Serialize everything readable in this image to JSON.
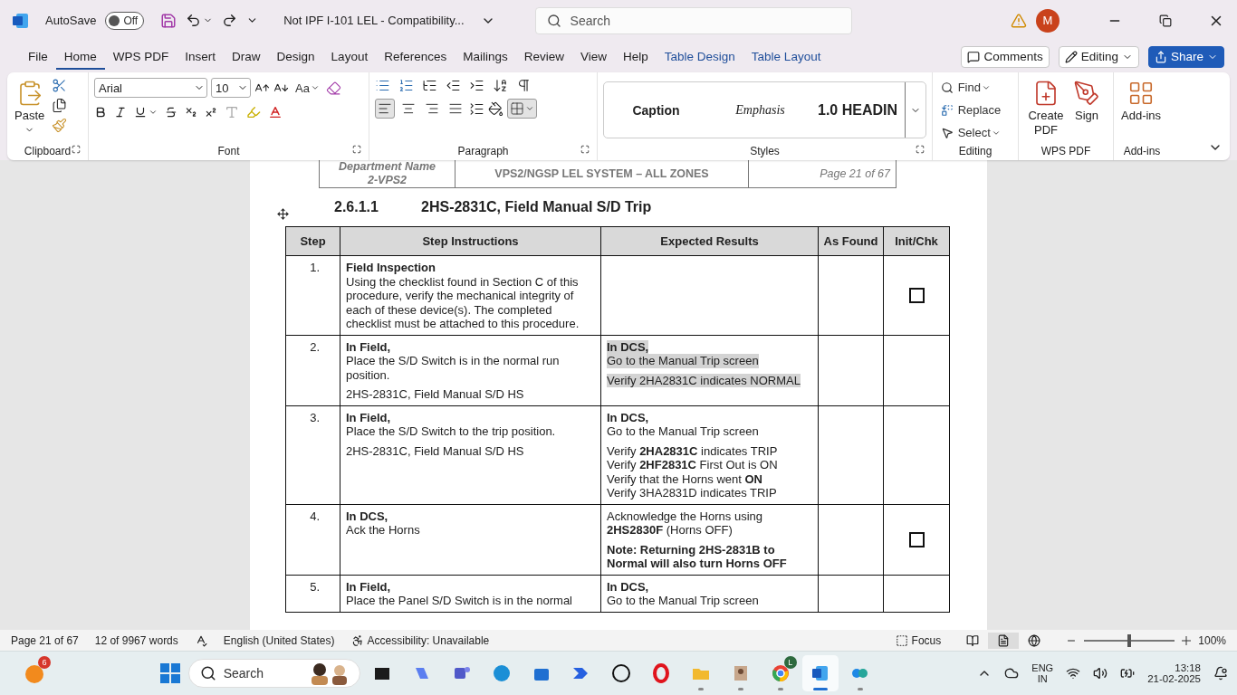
{
  "title_bar": {
    "autosave_label": "AutoSave",
    "autosave": {
      "on": false,
      "label": "Off"
    },
    "document_title": "Not IPF I-101 LEL  -  Compatibility...",
    "search_placeholder": "Search",
    "avatar": "M"
  },
  "menu_tabs": [
    {
      "label": "File",
      "selected": false,
      "kind": "plain"
    },
    {
      "label": "Home",
      "selected": true,
      "kind": "plain"
    },
    {
      "label": "WPS PDF",
      "selected": false,
      "kind": "plain"
    },
    {
      "label": "Insert",
      "selected": false,
      "kind": "plain"
    },
    {
      "label": "Draw",
      "selected": false,
      "kind": "plain"
    },
    {
      "label": "Design",
      "selected": false,
      "kind": "plain"
    },
    {
      "label": "Layout",
      "selected": false,
      "kind": "plain"
    },
    {
      "label": "References",
      "selected": false,
      "kind": "plain"
    },
    {
      "label": "Mailings",
      "selected": false,
      "kind": "plain"
    },
    {
      "label": "Review",
      "selected": false,
      "kind": "plain"
    },
    {
      "label": "View",
      "selected": false,
      "kind": "plain"
    },
    {
      "label": "Help",
      "selected": false,
      "kind": "plain"
    },
    {
      "label": "Table Design",
      "selected": false,
      "kind": "contextual"
    },
    {
      "label": "Table Layout",
      "selected": false,
      "kind": "contextual"
    }
  ],
  "header_buttons": {
    "comments": "Comments",
    "editing": "Editing",
    "share": "Share"
  },
  "ribbon": {
    "clipboard": {
      "label": "Clipboard",
      "paste": "Paste"
    },
    "font": {
      "label": "Font",
      "name": "Arial",
      "size": "10",
      "change_case": "Aa"
    },
    "paragraph": {
      "label": "Paragraph",
      "borders_selected": true,
      "alignment": [
        {
          "kind": "left",
          "selected": true
        },
        {
          "kind": "center",
          "selected": false
        },
        {
          "kind": "right",
          "selected": false
        },
        {
          "kind": "justify",
          "selected": false
        }
      ]
    },
    "styles": {
      "label": "Styles",
      "items": [
        {
          "label": "Caption",
          "kind": "caption"
        },
        {
          "label": "Emphasis",
          "kind": "emphasis"
        },
        {
          "label": "1.0  HEADIN",
          "kind": "heading"
        }
      ]
    },
    "editing": {
      "label": "Editing",
      "find": "Find",
      "replace": "Replace",
      "select": "Select"
    },
    "wps": {
      "label": "WPS PDF",
      "create": "Create PDF",
      "sign": "Sign"
    },
    "addins": {
      "label": "Add-ins",
      "button": "Add-ins"
    }
  },
  "document": {
    "header": {
      "department_label": "Department Name",
      "department": "2-VPS2",
      "system": "VPS2/NGSP LEL SYSTEM – ALL ZONES",
      "page": "Page 21 of 67"
    },
    "heading": {
      "number": "2.6.1.1",
      "title": "2HS-2831C, Field Manual S/D Trip"
    },
    "table": {
      "columns": [
        "Step",
        "Step Instructions",
        "Expected Results",
        "As Found",
        "Init/Chk"
      ],
      "rows": [
        {
          "step": "1.",
          "instructions": [
            [
              {
                "text": "Field Inspection",
                "kind": "bold"
              },
              {
                "text": "Using the checklist found in Section C of this procedure, verify the mechanical integrity of each of these device(s). The completed checklist must be attached to this procedure.",
                "kind": "plain"
              }
            ]
          ],
          "results": [],
          "checkbox": {
            "checked": false
          }
        },
        {
          "step": "2.",
          "instructions": [
            [
              {
                "text": "In Field,",
                "kind": "bold"
              },
              {
                "text": "Place the S/D Switch is in the normal run position.",
                "kind": "plain"
              }
            ],
            [
              {
                "text": "2HS-2831C, Field Manual S/D HS",
                "kind": "plain"
              }
            ]
          ],
          "results": [
            [
              {
                "text": "In DCS,",
                "kind": "bold",
                "highlight": true
              },
              {
                "text": "Go to the Manual Trip screen",
                "kind": "plain",
                "highlight": true
              }
            ],
            [
              {
                "text": "Verify 2HA2831C indicates NORMAL",
                "kind": "plain",
                "highlight": true
              }
            ]
          ]
        },
        {
          "step": "3.",
          "instructions": [
            [
              {
                "text": "In Field,",
                "kind": "bold"
              },
              {
                "text": "Place the S/D Switch to the trip position.",
                "kind": "plain"
              }
            ],
            [
              {
                "text": "2HS-2831C, Field Manual S/D HS",
                "kind": "plain"
              }
            ]
          ],
          "results": [
            [
              {
                "text": "In DCS,",
                "kind": "bold"
              },
              {
                "text": "Go to the Manual Trip screen",
                "kind": "plain"
              }
            ],
            [
              {
                "text": "Verify **2HA2831C** indicates TRIP",
                "kind": "plain"
              },
              {
                "text": "Verify **2HF2831C** First Out is ON",
                "kind": "plain"
              },
              {
                "text": "Verify that the Horns went **ON**",
                "kind": "plain"
              },
              {
                "text": "Verify 3HA2831D indicates TRIP",
                "kind": "plain"
              }
            ]
          ]
        },
        {
          "step": "4.",
          "instructions": [
            [
              {
                "text": "In DCS,",
                "kind": "bold"
              },
              {
                "text": "Ack the Horns",
                "kind": "plain"
              }
            ]
          ],
          "results": [
            [
              {
                "text": "Acknowledge the Horns using **2HS2830F** (Horns OFF)",
                "kind": "plain"
              }
            ],
            [
              {
                "text": "Note: Returning 2HS-2831B to Normal will also turn Horns OFF",
                "kind": "bold"
              }
            ]
          ],
          "checkbox": {
            "checked": false
          }
        },
        {
          "step": "5.",
          "instructions": [
            [
              {
                "text": "In Field,",
                "kind": "bold"
              },
              {
                "text": "Place the Panel S/D Switch is in the normal",
                "kind": "plain"
              }
            ]
          ],
          "results": [
            [
              {
                "text": "In DCS,",
                "kind": "bold"
              },
              {
                "text": "Go to the Manual Trip screen",
                "kind": "plain"
              }
            ]
          ]
        }
      ]
    }
  },
  "status_bar": {
    "page": "Page 21 of 67",
    "words": "12 of 9967 words",
    "language": "English (United States)",
    "accessibility": "Accessibility: Unavailable",
    "focus": "Focus",
    "views": [
      {
        "kind": "read",
        "selected": false
      },
      {
        "kind": "print",
        "selected": true
      },
      {
        "kind": "web",
        "selected": false
      }
    ],
    "zoom": {
      "level": 0.5,
      "reading": "100%"
    }
  },
  "taskbar": {
    "weather_badge": "6",
    "search_placeholder": "Search",
    "apps": [
      {
        "kind": "terminal",
        "selected": false,
        "running": false
      },
      {
        "kind": "copilot",
        "selected": false,
        "running": false
      },
      {
        "kind": "teams",
        "selected": false,
        "running": false
      },
      {
        "kind": "edge",
        "selected": false,
        "running": false
      },
      {
        "kind": "store",
        "selected": false,
        "running": false
      },
      {
        "kind": "automate",
        "selected": false,
        "running": false
      },
      {
        "kind": "dell",
        "selected": false,
        "running": false
      },
      {
        "kind": "opera",
        "selected": false,
        "running": false
      },
      {
        "kind": "explorer",
        "selected": false,
        "running": true
      },
      {
        "kind": "viewer",
        "selected": false,
        "running": true
      },
      {
        "kind": "chrome",
        "selected": false,
        "running": true,
        "badge": "L"
      },
      {
        "kind": "word",
        "selected": true,
        "running": true
      },
      {
        "kind": "widgets",
        "selected": false,
        "running": true
      }
    ],
    "lang_primary": "ENG",
    "lang_secondary": "IN",
    "time": "13:18",
    "date": "21-02-2025"
  }
}
